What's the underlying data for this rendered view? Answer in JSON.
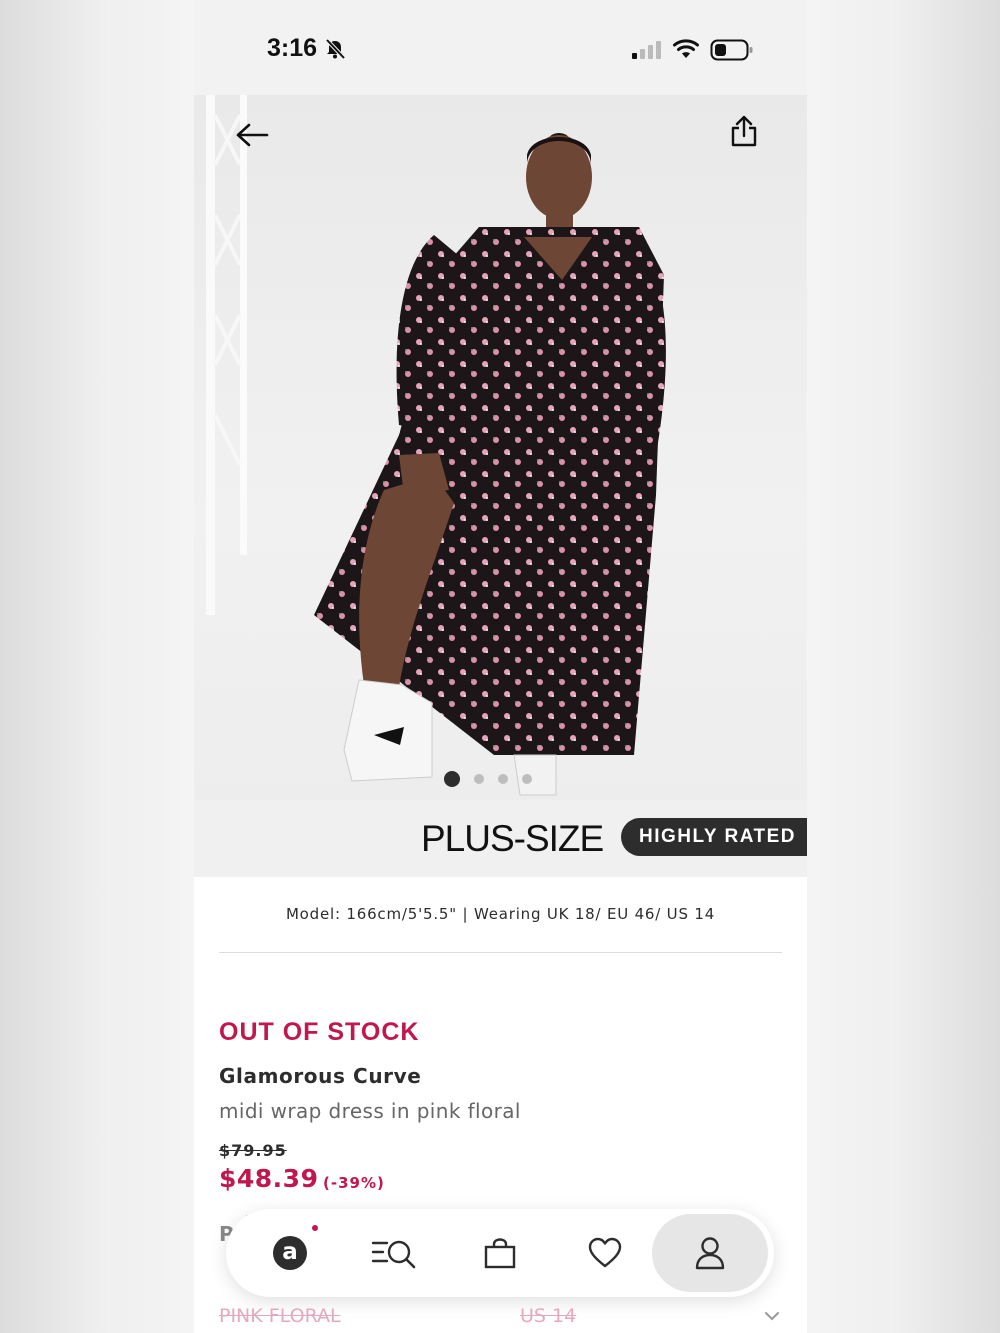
{
  "status_bar": {
    "time": "3:16"
  },
  "hero": {
    "carousel_total": 4,
    "carousel_active": 1
  },
  "badges": {
    "plus_size": "PLUS-SIZE",
    "highly_rated": "HIGHLY RATED"
  },
  "product": {
    "model_info": "Model: 166cm/5'5.5\" | Wearing UK 18/ EU 46/ US 14",
    "stock_status": "OUT OF STOCK",
    "brand": "Glamorous Curve",
    "name": "midi wrap dress in pink floral",
    "was_price": "$79.95",
    "now_price": "$48.39",
    "discount": "(-39%)",
    "partial_label": "P",
    "colour": "PINK FLORAL",
    "size": "US 14"
  },
  "nav": {
    "items": [
      "home-icon",
      "search-icon",
      "bag-icon",
      "heart-icon",
      "account-icon"
    ],
    "active": "account"
  },
  "colors": {
    "accent": "#c0174d",
    "dark": "#2d2d2d"
  }
}
